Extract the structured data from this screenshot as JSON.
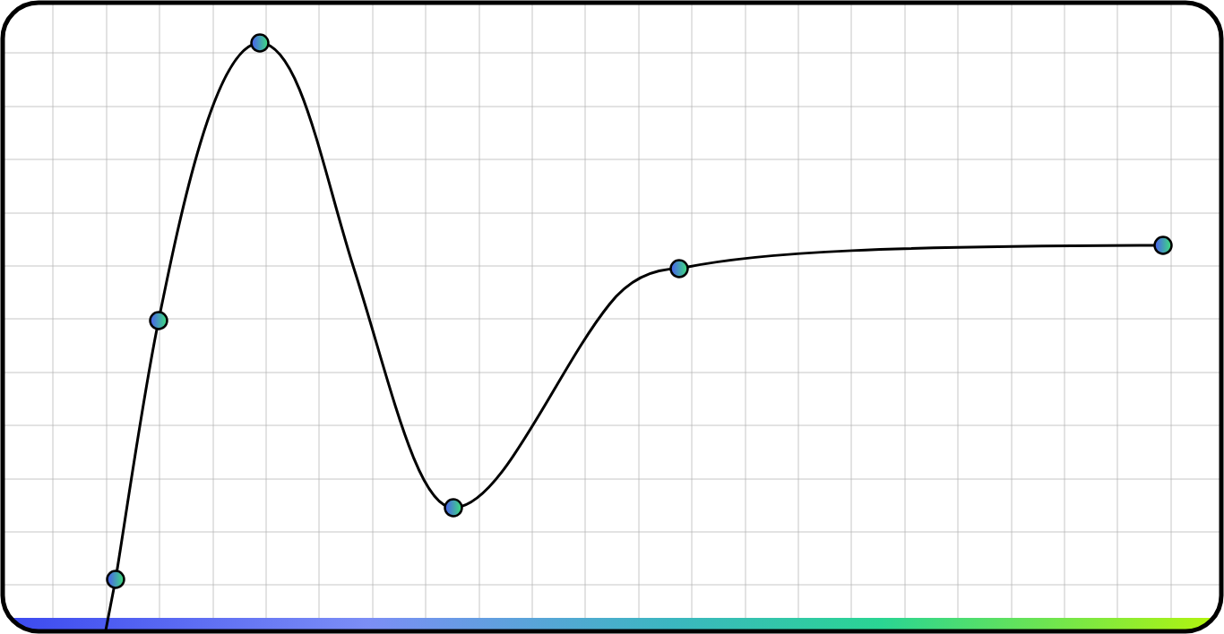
{
  "diagram": {
    "kind": "curve"
  }
}
